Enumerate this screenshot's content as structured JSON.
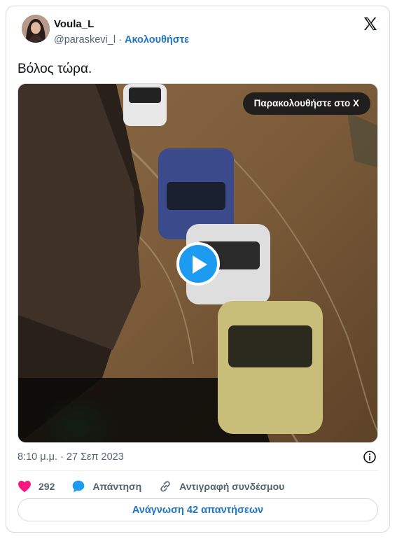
{
  "author": {
    "name": "Voula_L",
    "handle": "@paraskevi_l",
    "separator": "·",
    "follow_label": "Ακολουθήστε"
  },
  "tweet": {
    "text": "Βόλος τώρα.",
    "timestamp": "8:10 μ.μ. · 27 Σεπ 2023"
  },
  "media": {
    "watch_label": "Παρακολουθήστε στο X",
    "type": "video"
  },
  "actions": {
    "likes_count": "292",
    "reply_label": "Απάντηση",
    "copy_link_label": "Αντιγραφή συνδέσμου"
  },
  "read_replies_label": "Ανάγνωση 42 απαντήσεων",
  "colors": {
    "accent": "#1d9bf0",
    "link": "#1d75c9",
    "like": "#f91880",
    "muted": "#536471"
  },
  "icons": [
    "x-logo-icon",
    "play-icon",
    "info-icon",
    "heart-icon",
    "reply-bubble-icon",
    "link-icon"
  ]
}
